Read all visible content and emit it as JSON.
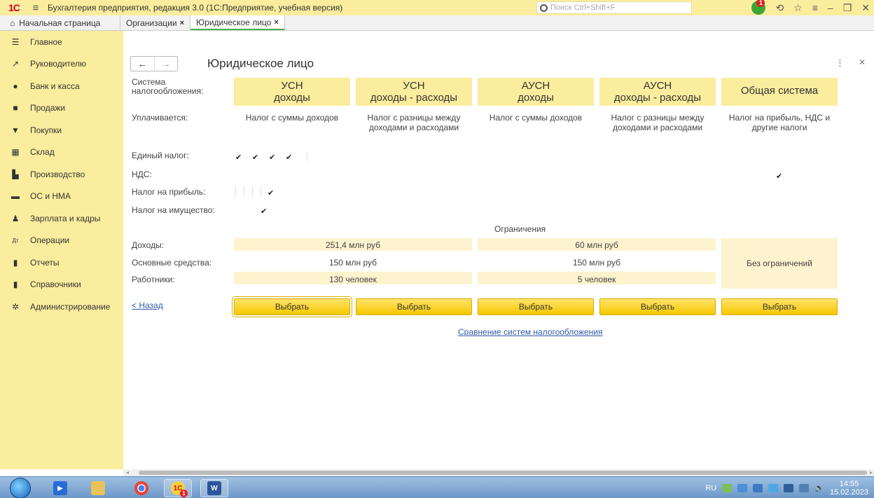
{
  "window": {
    "logo": "1С",
    "title": "Бухгалтерия предприятия, редакция 3.0  (1С:Предприятие, учебная версия)",
    "search_placeholder": "Поиск Ctrl+Shift+F",
    "notifications_count": "1"
  },
  "tabs": [
    {
      "label": "Начальная страница",
      "icon": "home-icon"
    },
    {
      "label": "Организации",
      "closable": true
    },
    {
      "label": "Юридическое лицо",
      "closable": true,
      "active": true
    }
  ],
  "sidebar": {
    "items": [
      {
        "label": "Главное",
        "icon": "menu-icon"
      },
      {
        "label": "Руководителю",
        "icon": "chart-trend-icon"
      },
      {
        "label": "Банк и касса",
        "icon": "coin-icon"
      },
      {
        "label": "Продажи",
        "icon": "shopping-bag-icon"
      },
      {
        "label": "Покупки",
        "icon": "cart-icon"
      },
      {
        "label": "Склад",
        "icon": "warehouse-icon"
      },
      {
        "label": "Производство",
        "icon": "factory-icon"
      },
      {
        "label": "ОС и НМА",
        "icon": "truck-icon"
      },
      {
        "label": "Зарплата и кадры",
        "icon": "person-icon"
      },
      {
        "label": "Операции",
        "icon": "dt-kt-icon"
      },
      {
        "label": "Отчеты",
        "icon": "bar-chart-icon"
      },
      {
        "label": "Справочники",
        "icon": "book-icon"
      },
      {
        "label": "Администрирование",
        "icon": "gear-icon"
      }
    ]
  },
  "form": {
    "title": "Юридическое лицо",
    "labels": {
      "tax_system": "Система налогообложения:",
      "paid": "Уплачивается:",
      "single_tax": "Единый налог:",
      "vat": "НДС:",
      "profit_tax": "Налог на прибыль:",
      "property_tax": "Налог на имущество:",
      "income": "Доходы:",
      "fixed_assets": "Основные средства:",
      "employees": "Работники:"
    },
    "systems": [
      {
        "line1": "УСН",
        "line2": "доходы",
        "desc": "Налог с суммы доходов"
      },
      {
        "line1": "УСН",
        "line2": "доходы - расходы",
        "desc": "Налог с разницы между доходами и расходами"
      },
      {
        "line1": "АУСН",
        "line2": "доходы",
        "desc": "Налог с суммы доходов"
      },
      {
        "line1": "АУСН",
        "line2": "доходы - расходы",
        "desc": "Налог с разницы между доходами и расходами"
      },
      {
        "line1": "Общая система",
        "line2": "",
        "desc": "Налог на прибыль, НДС и другие налоги"
      }
    ],
    "checkmark": "✔",
    "limits_title": "Ограничения",
    "limits": {
      "usn_income": "251,4 млн руб",
      "ausn_income": "60 млн руб",
      "usn_assets": "150 млн руб",
      "ausn_assets": "150 млн руб",
      "usn_employees": "130 человек",
      "ausn_employees": "5 человек",
      "general": "Без ограничений"
    },
    "back_link": "< Назад",
    "choose_label": "Выбрать",
    "compare_link": "Сравнение систем налогообложения"
  },
  "taskbar": {
    "lang": "RU",
    "time": "14:55",
    "date": "15.02.2023",
    "onec_badge": "1"
  }
}
